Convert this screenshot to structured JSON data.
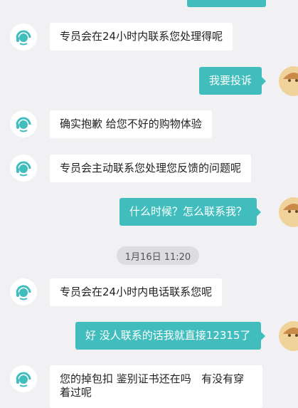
{
  "chat": {
    "messages": [
      {
        "sender": "agent",
        "text": "专员会在24小时内联系您处理得呢"
      },
      {
        "sender": "user",
        "text": "我要投诉"
      },
      {
        "sender": "agent",
        "text": "确实抱歉 给您不好的购物体验"
      },
      {
        "sender": "agent",
        "text": "专员会主动联系您处理您反馈的问题呢"
      },
      {
        "sender": "user",
        "text": "什么时候？怎么联系我？"
      },
      {
        "sender": "agent",
        "text": "专员会在24小时内电话联系您呢"
      },
      {
        "sender": "user",
        "text": "好 没人联系的话我就直接12315了"
      },
      {
        "sender": "agent",
        "text": "您的掉包扣 鉴别证书还在吗   有没有穿着过呢"
      }
    ],
    "timestamp": "1月16日 11:20"
  },
  "icons": {
    "agent_avatar": "customer-service-headset-icon",
    "user_avatar": "user-avatar"
  },
  "colors": {
    "background": "#f1f1f4",
    "user_bubble": "#41bdbd",
    "agent_bubble": "#ffffff",
    "timestamp_pill": "#dcdce1"
  }
}
